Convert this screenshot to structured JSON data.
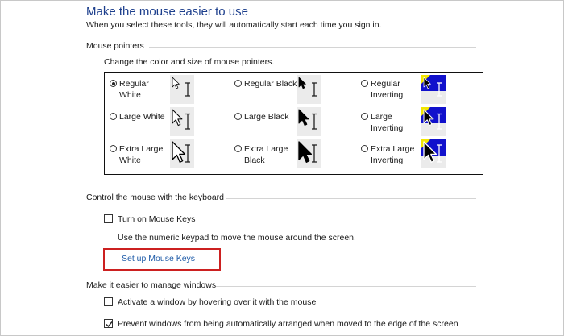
{
  "page": {
    "title": "Make the mouse easier to use",
    "subtitle": "When you select these tools, they will automatically start each time you sign in."
  },
  "mouse_pointers": {
    "heading": "Mouse pointers",
    "description": "Change the color and size of mouse pointers.",
    "options": [
      {
        "label": "Regular White",
        "selected": true,
        "scheme": "white",
        "size": "regular"
      },
      {
        "label": "Regular Black",
        "selected": false,
        "scheme": "black",
        "size": "regular"
      },
      {
        "label": "Regular Inverting",
        "selected": false,
        "scheme": "inverting",
        "size": "regular"
      },
      {
        "label": "Large White",
        "selected": false,
        "scheme": "white",
        "size": "large"
      },
      {
        "label": "Large Black",
        "selected": false,
        "scheme": "black",
        "size": "large"
      },
      {
        "label": "Large Inverting",
        "selected": false,
        "scheme": "inverting",
        "size": "large"
      },
      {
        "label": "Extra Large White",
        "selected": false,
        "scheme": "white",
        "size": "extra-large"
      },
      {
        "label": "Extra Large Black",
        "selected": false,
        "scheme": "black",
        "size": "extra-large"
      },
      {
        "label": "Extra Large Inverting",
        "selected": false,
        "scheme": "inverting",
        "size": "extra-large"
      }
    ]
  },
  "keyboard": {
    "heading": "Control the mouse with the keyboard",
    "mouse_keys_label": "Turn on Mouse Keys",
    "mouse_keys_checked": false,
    "mouse_keys_description": "Use the numeric keypad to move the mouse around the screen.",
    "setup_link": "Set up Mouse Keys"
  },
  "windows": {
    "heading": "Make it easier to manage windows",
    "hover_label": "Activate a window by hovering over it with the mouse",
    "hover_checked": false,
    "snap_label": "Prevent windows from being automatically arranged when moved to the edge of the screen",
    "snap_checked": true
  },
  "colors": {
    "title": "#1c3e8c",
    "link": "#1e5ba8",
    "highlight": "#cc2020",
    "inverting_fill": "#1111cc",
    "inverting_accent": "#f2e600"
  },
  "icons": [
    "arrow-pointer-icon",
    "text-beam-icon",
    "checkmark-icon"
  ]
}
